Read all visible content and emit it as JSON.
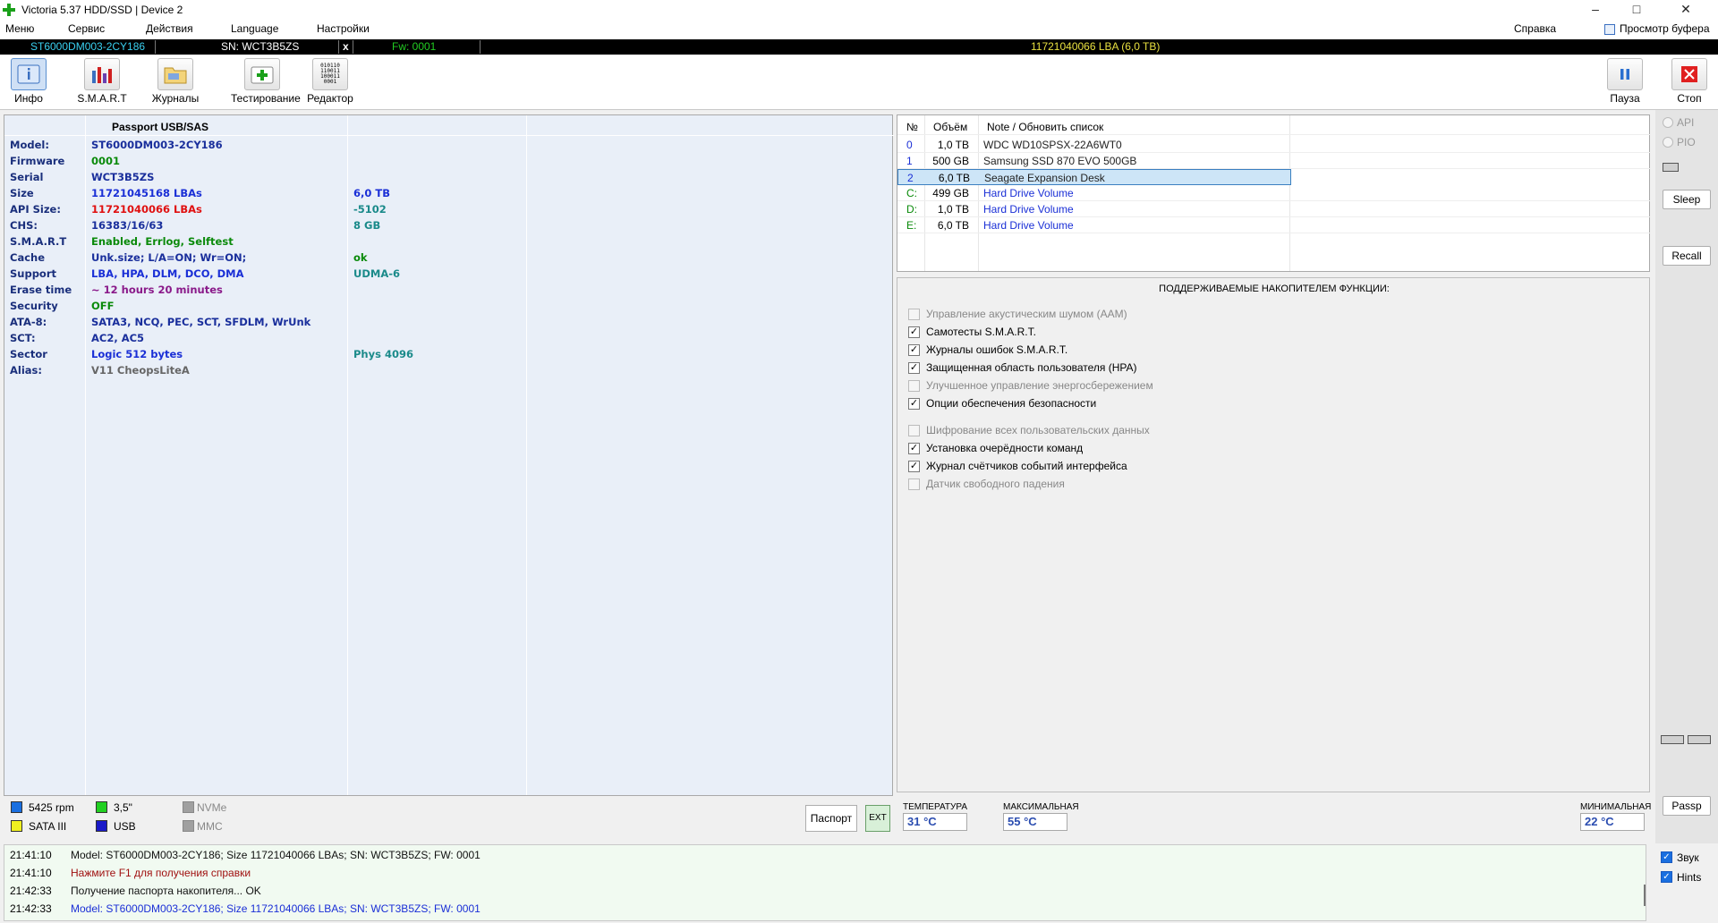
{
  "app": {
    "title": "Victoria 5.37 HDD/SSD | Device 2",
    "window_controls": {
      "minimize": "–",
      "maximize": "□",
      "close": "✕"
    }
  },
  "menu": {
    "items": [
      "Меню",
      "Сервис",
      "Действия",
      "Language",
      "Настройки"
    ],
    "right": [
      "Справка",
      "Просмотр буфера"
    ]
  },
  "strip": {
    "model": "ST6000DM003-2CY186",
    "sn": "SN: WCT3B5ZS",
    "x": "x",
    "fw": "Fw: 0001",
    "lba": "11721040066 LBA (6,0 TB)"
  },
  "toolbar": {
    "info": "Инфо",
    "smart": "S.M.A.R.T",
    "logs": "Журналы",
    "test": "Тестирование",
    "editor": "Редактор",
    "pause": "Пауза",
    "stop": "Стоп"
  },
  "passport": {
    "header": "Passport USB/SAS",
    "rows": [
      {
        "label": "Model:",
        "value": "ST6000DM003-2CY186",
        "extra": "",
        "vcolor": "#1a2f9c",
        "ecolor": "#1a2f9c"
      },
      {
        "label": "Firmware",
        "value": "0001",
        "extra": "",
        "vcolor": "#0a8a0a",
        "ecolor": "#0a8a0a"
      },
      {
        "label": "Serial",
        "value": "WCT3B5ZS",
        "extra": "",
        "vcolor": "#1a2f9c",
        "ecolor": "#1a2f9c"
      },
      {
        "label": "Size",
        "value": "11721045168 LBAs",
        "extra": "6,0 TB",
        "vcolor": "#1a2fd6",
        "ecolor": "#1a2fd6"
      },
      {
        "label": "API Size:",
        "value": "11721040066 LBAs",
        "extra": "-5102",
        "vcolor": "#e01010",
        "ecolor": "#1a8a8a"
      },
      {
        "label": "CHS:",
        "value": "16383/16/63",
        "extra": "8 GB",
        "vcolor": "#1a2f9c",
        "ecolor": "#1a8a8a"
      },
      {
        "label": "S.M.A.R.T",
        "value": "Enabled, Errlog, Selftest",
        "extra": "",
        "vcolor": "#0a8a0a",
        "ecolor": "#0a8a0a"
      },
      {
        "label": "Cache",
        "value": "Unk.size; L/A=ON; Wr=ON;",
        "extra": "ok",
        "vcolor": "#1a2f9c",
        "ecolor": "#0a8a0a"
      },
      {
        "label": "Support",
        "value": "LBA, HPA, DLM, DCO, DMA",
        "extra": "UDMA-6",
        "vcolor": "#1a2fd6",
        "ecolor": "#1a8a8a"
      },
      {
        "label": "Erase time",
        "value": "~ 12 hours 20 minutes",
        "extra": "",
        "vcolor": "#8a1a8a",
        "ecolor": "#8a1a8a"
      },
      {
        "label": "Security",
        "value": "OFF",
        "extra": "",
        "vcolor": "#0a8a0a",
        "ecolor": "#0a8a0a"
      },
      {
        "label": "ATA-8:",
        "value": "SATA3, NCQ, PEC, SCT, SFDLM, WrUnk",
        "extra": "",
        "vcolor": "#1a2f9c",
        "ecolor": "#1a2f9c"
      },
      {
        "label": "SCT:",
        "value": "AC2, AC5",
        "extra": "",
        "vcolor": "#1a2f9c",
        "ecolor": "#1a2f9c"
      },
      {
        "label": "Sector",
        "value": "Logic 512 bytes",
        "extra": "Phys 4096",
        "vcolor": "#1a2fd6",
        "ecolor": "#1a8a8a"
      },
      {
        "label": "Alias:",
        "value": "V11 CheopsLiteA",
        "extra": "",
        "vcolor": "#666666",
        "ecolor": "#666666"
      }
    ]
  },
  "drives": {
    "headers": [
      "№",
      "Объём",
      "Note / Обновить список"
    ],
    "rows": [
      {
        "num": "0",
        "size": "1,0 TB",
        "note": "WDC WD10SPSX-22A6WT0",
        "ncolor": "#222222",
        "numcolor": "#1a2fd6"
      },
      {
        "num": "1",
        "size": "500 GB",
        "note": "Samsung SSD 870 EVO 500GB",
        "ncolor": "#222222",
        "numcolor": "#1a2fd6"
      },
      {
        "num": "2",
        "size": "6,0 TB",
        "note": "Seagate Expansion Desk",
        "ncolor": "#222222",
        "numcolor": "#1a2fd6"
      },
      {
        "num": "C:",
        "size": "499 GB",
        "note": "Hard Drive Volume",
        "ncolor": "#1a2fd6",
        "numcolor": "#0a8a0a"
      },
      {
        "num": "D:",
        "size": "1,0 TB",
        "note": "Hard Drive Volume",
        "ncolor": "#1a2fd6",
        "numcolor": "#0a8a0a"
      },
      {
        "num": "E:",
        "size": "6,0 TB",
        "note": "Hard Drive Volume",
        "ncolor": "#1a2fd6",
        "numcolor": "#0a8a0a"
      }
    ]
  },
  "features": {
    "title": "ПОДДЕРЖИВАЕМЫЕ НАКОПИТЕЛЕМ ФУНКЦИИ:",
    "items": [
      {
        "label": "Управление акустическим шумом (AAM)",
        "checked": false
      },
      {
        "label": "Самотесты S.M.A.R.T.",
        "checked": true
      },
      {
        "label": "Журналы ошибок S.M.A.R.T.",
        "checked": true
      },
      {
        "label": "Защищенная область пользователя (HPA)",
        "checked": true
      },
      {
        "label": "Улучшенное управление энергосбережением",
        "checked": false
      },
      {
        "label": "Опции обеспечения безопасности",
        "checked": true
      },
      {
        "label": "Шифрование всех пользовательских данных",
        "checked": false
      },
      {
        "label": "Установка очерёдности команд",
        "checked": true
      },
      {
        "label": "Журнал счётчиков событий интерфейса",
        "checked": true
      },
      {
        "label": "Датчик свободного падения",
        "checked": false
      }
    ]
  },
  "side": {
    "api": "API",
    "pio": "PIO",
    "sleep": "Sleep",
    "recall": "Recall",
    "passp": "Passp",
    "sound": "Звук",
    "hints": "Hints"
  },
  "status": {
    "rpm": "5425 rpm",
    "form": "3,5\"",
    "nvme": "NVMe",
    "sata": "SATA III",
    "usb": "USB",
    "mmc": "MMC",
    "passport_btn": "Паспорт",
    "ext_btn": "EXT"
  },
  "temps": {
    "temp_label": "ТЕМПЕРАТУРА",
    "temp_value": "31 °C",
    "max_label": "МАКСИМАЛЬНАЯ",
    "max_value": "55 °C",
    "min_label": "МИНИМАЛЬНАЯ",
    "min_value": "22 °C"
  },
  "log": [
    {
      "time": "21:41:10",
      "text": "Model: ST6000DM003-2CY186; Size 11721040066 LBAs; SN: WCT3B5ZS; FW: 0001",
      "color": "#111111"
    },
    {
      "time": "21:41:10",
      "text": "Нажмите F1 для получения справки",
      "color": "#a01010"
    },
    {
      "time": "21:42:33",
      "text": "Получение паспорта накопителя... OK",
      "color": "#111111"
    },
    {
      "time": "21:42:33",
      "text": "Model: ST6000DM003-2CY186; Size 11721040066 LBAs; SN: WCT3B5ZS; FW: 0001",
      "color": "#1a2fd6"
    }
  ],
  "colors": {
    "strip_model": "#3ad0f0",
    "strip_fw": "#22cc22",
    "strip_lba": "#e8e040",
    "accent_red": "#e02020"
  }
}
